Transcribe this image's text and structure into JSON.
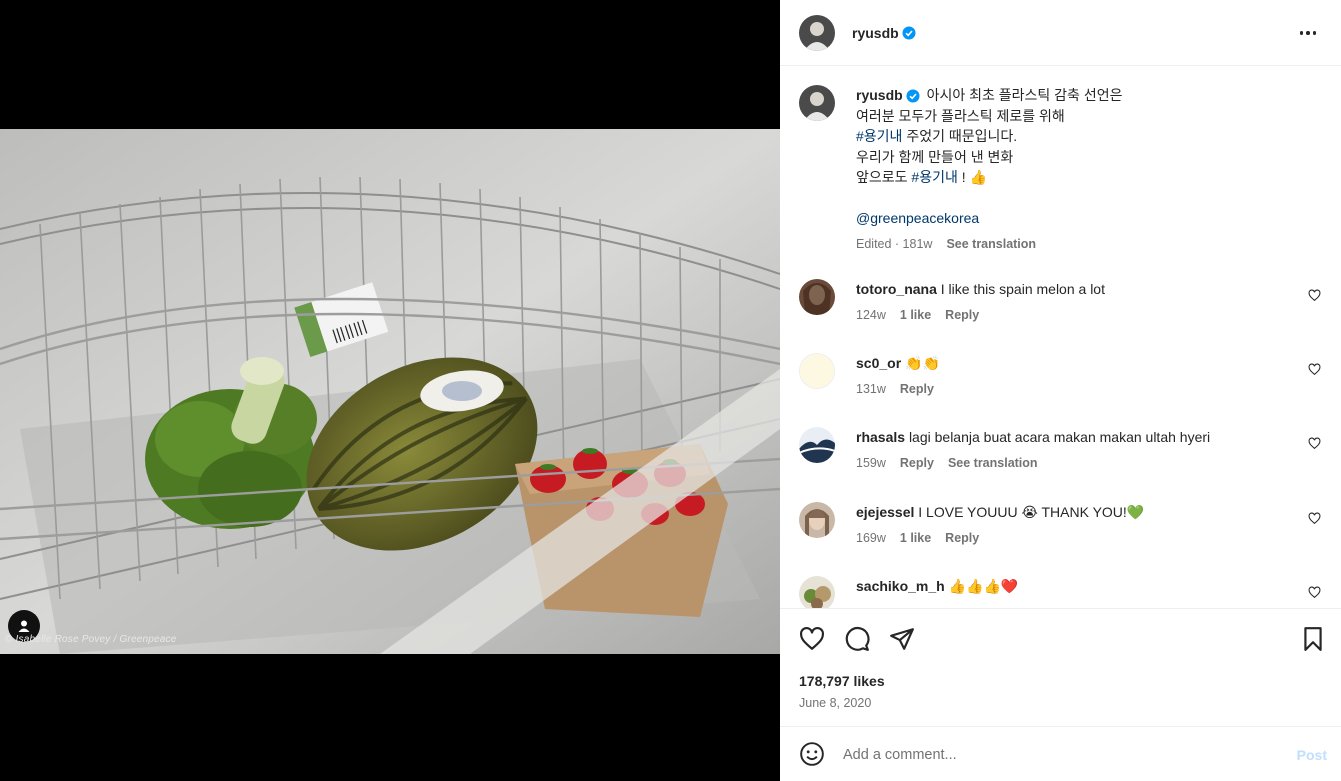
{
  "photo": {
    "credit": "© Isabelle Rose Povey / Greenpeace"
  },
  "header": {
    "username": "ryusdb"
  },
  "caption": {
    "username": "ryusdb",
    "line1": "아시아 최초 플라스틱 감축 선언은",
    "line2": "여러분 모두가 플라스틱 제로를 위해",
    "line3_tag": "#용기내",
    "line3_rest": " 주었기 때문입니다.",
    "line4": "우리가 함께 만들어 낸 변화",
    "line5_pre": "앞으로도 ",
    "line5_tag": "#용기내",
    "line5_post": " ! 👍",
    "mention": "@greenpeacekorea",
    "edited": "Edited · 181w",
    "see_translation": "See translation"
  },
  "comments": [
    {
      "username": "totoro_nana",
      "text": "I like this spain melon a lot",
      "age": "124w",
      "likes": "1 like",
      "reply": "Reply"
    },
    {
      "username": "sc0_or",
      "text": "👏👏",
      "age": "131w",
      "reply": "Reply"
    },
    {
      "username": "rhasals",
      "text": "lagi belanja buat acara makan makan ultah hyeri",
      "age": "159w",
      "reply": "Reply",
      "see_translation": "See translation"
    },
    {
      "username": "ejejessel",
      "text": "I LOVE YOUUU 😭 THANK YOU!💚",
      "age": "169w",
      "likes": "1 like",
      "reply": "Reply"
    },
    {
      "username": "sachiko_m_h",
      "text": "👍👍👍❤️"
    }
  ],
  "actions": {
    "likes": "178,797 likes",
    "date": "June 8, 2020"
  },
  "composer": {
    "placeholder": "Add a comment...",
    "post": "Post"
  },
  "colors": {
    "accent": "#0095f6",
    "tag": "#00376b",
    "verified": "#0095f6"
  }
}
